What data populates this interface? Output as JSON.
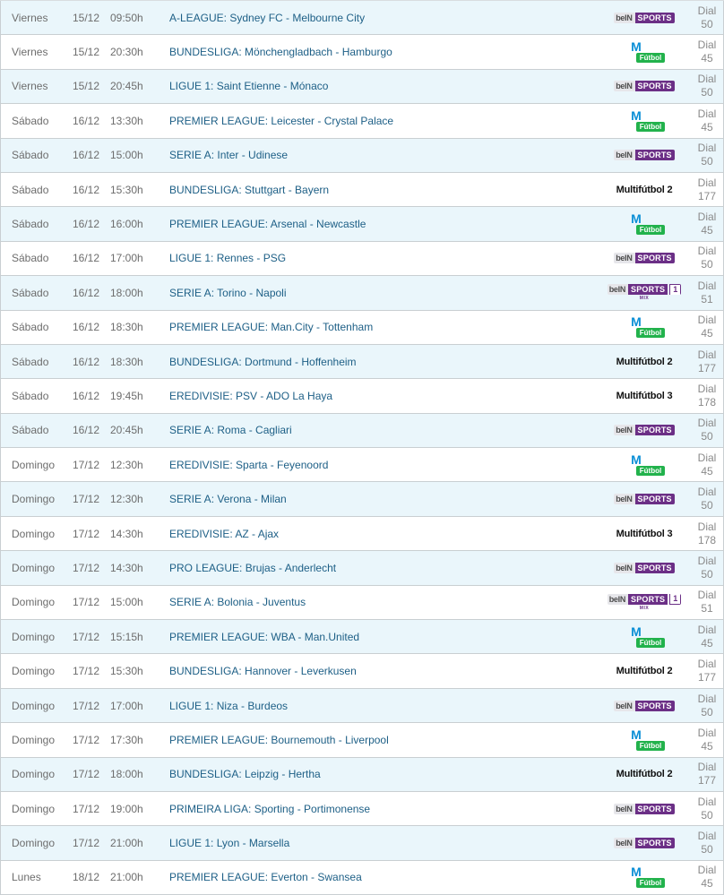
{
  "colors": {
    "row_alt_bg": "#eaf6fb",
    "match_text": "#1d5f86",
    "meta_text": "#6d6d6d",
    "bein_purple": "#6b2f86",
    "movistar_blue": "#0b8fd6",
    "futbol_green": "#22b24c"
  },
  "rows": [
    {
      "day": "Viernes",
      "date": "15/12",
      "time": "09:50h",
      "match": "A-LEAGUE: Sydney FC - Melbourne City",
      "channel": "bein",
      "dial": "50"
    },
    {
      "day": "Viernes",
      "date": "15/12",
      "time": "20:30h",
      "match": "BUNDESLIGA: Mönchengladbach - Hamburgo",
      "channel": "movistar",
      "dial": "45"
    },
    {
      "day": "Viernes",
      "date": "15/12",
      "time": "20:45h",
      "match": "LIGUE 1: Saint Etienne - Mónaco",
      "channel": "bein",
      "dial": "50"
    },
    {
      "day": "Sábado",
      "date": "16/12",
      "time": "13:30h",
      "match": "PREMIER LEAGUE: Leicester - Crystal Palace",
      "channel": "movistar",
      "dial": "45"
    },
    {
      "day": "Sábado",
      "date": "16/12",
      "time": "15:00h",
      "match": "SERIE A: Inter - Udinese",
      "channel": "bein",
      "dial": "50"
    },
    {
      "day": "Sábado",
      "date": "16/12",
      "time": "15:30h",
      "match": "BUNDESLIGA: Stuttgart - Bayern",
      "channel": "multi2",
      "dial": "177"
    },
    {
      "day": "Sábado",
      "date": "16/12",
      "time": "16:00h",
      "match": "PREMIER LEAGUE: Arsenal - Newcastle",
      "channel": "movistar",
      "dial": "45"
    },
    {
      "day": "Sábado",
      "date": "16/12",
      "time": "17:00h",
      "match": "LIGUE 1: Rennes - PSG",
      "channel": "bein",
      "dial": "50"
    },
    {
      "day": "Sábado",
      "date": "16/12",
      "time": "18:00h",
      "match": "SERIE A: Torino - Napoli",
      "channel": "bein1mix",
      "dial": "51"
    },
    {
      "day": "Sábado",
      "date": "16/12",
      "time": "18:30h",
      "match": "PREMIER LEAGUE: Man.City - Tottenham",
      "channel": "movistar",
      "dial": "45"
    },
    {
      "day": "Sábado",
      "date": "16/12",
      "time": "18:30h",
      "match": "BUNDESLIGA: Dortmund - Hoffenheim",
      "channel": "multi2",
      "dial": "177"
    },
    {
      "day": "Sábado",
      "date": "16/12",
      "time": "19:45h",
      "match": "EREDIVISIE: PSV - ADO La Haya",
      "channel": "multi3",
      "dial": "178"
    },
    {
      "day": "Sábado",
      "date": "16/12",
      "time": "20:45h",
      "match": "SERIE A: Roma - Cagliari",
      "channel": "bein",
      "dial": "50"
    },
    {
      "day": "Domingo",
      "date": "17/12",
      "time": "12:30h",
      "match": "EREDIVISIE: Sparta - Feyenoord",
      "channel": "movistar",
      "dial": "45"
    },
    {
      "day": "Domingo",
      "date": "17/12",
      "time": "12:30h",
      "match": "SERIE A: Verona - Milan",
      "channel": "bein",
      "dial": "50"
    },
    {
      "day": "Domingo",
      "date": "17/12",
      "time": "14:30h",
      "match": "EREDIVISIE: AZ - Ajax",
      "channel": "multi3",
      "dial": "178"
    },
    {
      "day": "Domingo",
      "date": "17/12",
      "time": "14:30h",
      "match": "PRO LEAGUE: Brujas - Anderlecht",
      "channel": "bein",
      "dial": "50"
    },
    {
      "day": "Domingo",
      "date": "17/12",
      "time": "15:00h",
      "match": "SERIE A: Bolonia - Juventus",
      "channel": "bein1mix",
      "dial": "51"
    },
    {
      "day": "Domingo",
      "date": "17/12",
      "time": "15:15h",
      "match": "PREMIER LEAGUE: WBA - Man.United",
      "channel": "movistar",
      "dial": "45"
    },
    {
      "day": "Domingo",
      "date": "17/12",
      "time": "15:30h",
      "match": "BUNDESLIGA: Hannover - Leverkusen",
      "channel": "multi2",
      "dial": "177"
    },
    {
      "day": "Domingo",
      "date": "17/12",
      "time": "17:00h",
      "match": "LIGUE 1: Niza - Burdeos",
      "channel": "bein",
      "dial": "50"
    },
    {
      "day": "Domingo",
      "date": "17/12",
      "time": "17:30h",
      "match": "PREMIER LEAGUE: Bournemouth - Liverpool",
      "channel": "movistar",
      "dial": "45"
    },
    {
      "day": "Domingo",
      "date": "17/12",
      "time": "18:00h",
      "match": "BUNDESLIGA: Leipzig - Hertha",
      "channel": "multi2",
      "dial": "177"
    },
    {
      "day": "Domingo",
      "date": "17/12",
      "time": "19:00h",
      "match": "PRIMEIRA LIGA: Sporting - Portimonense",
      "channel": "bein",
      "dial": "50"
    },
    {
      "day": "Domingo",
      "date": "17/12",
      "time": "21:00h",
      "match": "LIGUE 1: Lyon - Marsella",
      "channel": "bein",
      "dial": "50"
    },
    {
      "day": "Lunes",
      "date": "18/12",
      "time": "21:00h",
      "match": "PREMIER LEAGUE: Everton - Swansea",
      "channel": "movistar",
      "dial": "45"
    }
  ],
  "logos": {
    "bein": {
      "part1": "beIN",
      "part2": "SPORTS"
    },
    "bein1mix": {
      "part1": "beIN",
      "part2": "SPORTS",
      "part3": "1",
      "sub": "MIX"
    },
    "movistar": {
      "mark": "M",
      "label": "Fútbol"
    },
    "multi2": {
      "label": "Multifútbol 2"
    },
    "multi3": {
      "label": "Multifútbol 3"
    }
  },
  "dial_label": "Dial"
}
